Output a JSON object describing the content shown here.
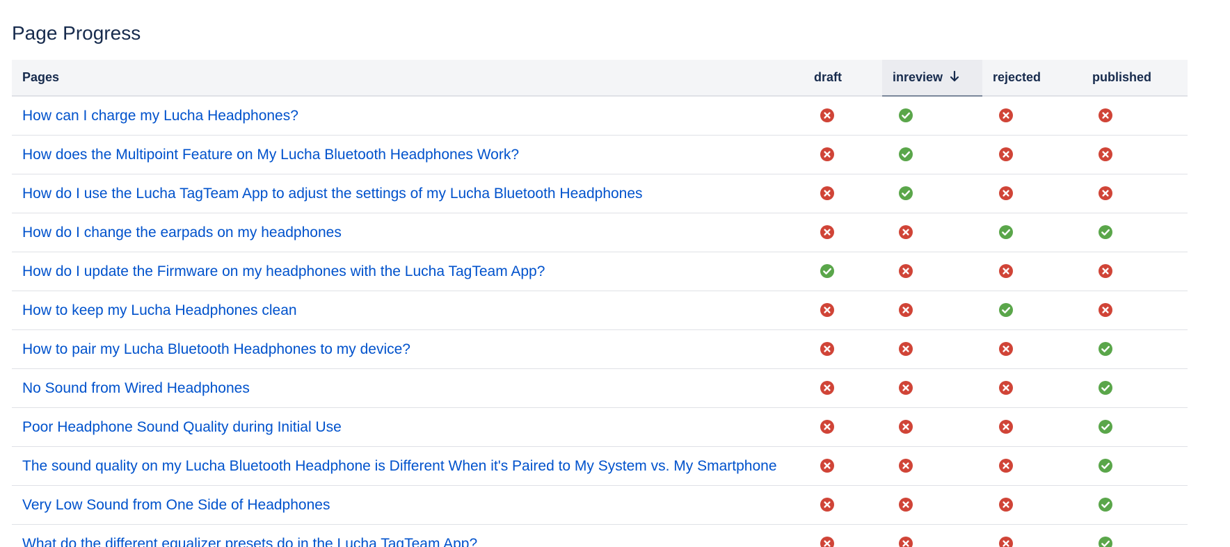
{
  "page_title": "Page Progress",
  "columns": {
    "pages": "Pages",
    "draft": "draft",
    "inreview": "inreview",
    "rejected": "rejected",
    "published": "published"
  },
  "sort": {
    "column": "inreview",
    "direction": "descending",
    "icon": "arrow-down-icon"
  },
  "colors": {
    "link": "#0052cc",
    "yes": "#5aa64a",
    "no": "#d04437",
    "header_bg": "#f4f5f7"
  },
  "rows": [
    {
      "title": "How can I charge my Lucha Headphones?",
      "draft": "no",
      "inreview": "yes",
      "rejected": "no",
      "published": "no"
    },
    {
      "title": "How does the Multipoint Feature on My Lucha Bluetooth Headphones Work?",
      "draft": "no",
      "inreview": "yes",
      "rejected": "no",
      "published": "no"
    },
    {
      "title": "How do I use the Lucha TagTeam App to adjust the settings of my Lucha Bluetooth Headphones",
      "draft": "no",
      "inreview": "yes",
      "rejected": "no",
      "published": "no"
    },
    {
      "title": "How do I change the earpads on my headphones",
      "draft": "no",
      "inreview": "no",
      "rejected": "yes",
      "published": "yes"
    },
    {
      "title": "How do I update the Firmware on my headphones with the Lucha TagTeam App?",
      "draft": "yes",
      "inreview": "no",
      "rejected": "no",
      "published": "no"
    },
    {
      "title": "How to keep my Lucha Headphones clean",
      "draft": "no",
      "inreview": "no",
      "rejected": "yes",
      "published": "no"
    },
    {
      "title": "How to pair my Lucha Bluetooth Headphones to my device?",
      "draft": "no",
      "inreview": "no",
      "rejected": "no",
      "published": "yes"
    },
    {
      "title": "No Sound from Wired Headphones",
      "draft": "no",
      "inreview": "no",
      "rejected": "no",
      "published": "yes"
    },
    {
      "title": "Poor Headphone Sound Quality during Initial Use",
      "draft": "no",
      "inreview": "no",
      "rejected": "no",
      "published": "yes"
    },
    {
      "title": "The sound quality on my Lucha Bluetooth Headphone is Different When it's Paired to My System vs. My Smartphone",
      "draft": "no",
      "inreview": "no",
      "rejected": "no",
      "published": "yes"
    },
    {
      "title": "Very Low Sound from One Side of Headphones",
      "draft": "no",
      "inreview": "no",
      "rejected": "no",
      "published": "yes"
    },
    {
      "title": "What do the different equalizer presets do in the Lucha TagTeam App?",
      "draft": "no",
      "inreview": "no",
      "rejected": "no",
      "published": "yes"
    }
  ]
}
